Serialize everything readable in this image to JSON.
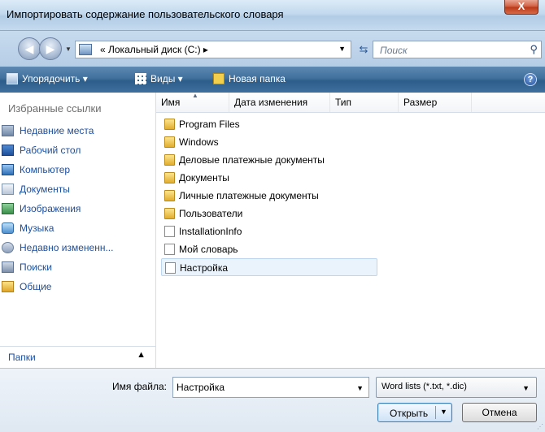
{
  "window": {
    "title": "Импортировать содержание пользовательского словаря",
    "close_glyph": "X"
  },
  "address": {
    "path": "« Локальный диск (C:) ▸",
    "search_placeholder": "Поиск"
  },
  "toolbar": {
    "organize_label": "Упорядочить ▾",
    "views_label": "Виды ▾",
    "new_folder_label": "Новая папка"
  },
  "sidebar": {
    "header": "Избранные ссылки",
    "items": [
      {
        "label": "Недавние места",
        "icon": "recent-places-icon"
      },
      {
        "label": "Рабочий стол",
        "icon": "desktop-icon"
      },
      {
        "label": "Компьютер",
        "icon": "computer-icon"
      },
      {
        "label": "Документы",
        "icon": "documents-icon"
      },
      {
        "label": "Изображения",
        "icon": "images-icon"
      },
      {
        "label": "Музыка",
        "icon": "music-icon"
      },
      {
        "label": "Недавно измененн...",
        "icon": "recently-changed-icon"
      },
      {
        "label": "Поиски",
        "icon": "searches-icon"
      },
      {
        "label": "Общие",
        "icon": "public-folder-icon"
      }
    ],
    "folders_label": "Папки"
  },
  "filelist": {
    "columns": [
      "Имя",
      "Дата изменения",
      "Тип",
      "Размер"
    ],
    "items": [
      {
        "name": "Program Files",
        "kind": "folder"
      },
      {
        "name": "Windows",
        "kind": "folder"
      },
      {
        "name": "Деловые платежные документы",
        "kind": "folder"
      },
      {
        "name": "Документы",
        "kind": "folder"
      },
      {
        "name": "Личные платежные документы",
        "kind": "folder"
      },
      {
        "name": "Пользователи",
        "kind": "folder"
      },
      {
        "name": "InstallationInfo",
        "kind": "file"
      },
      {
        "name": "Мой словарь",
        "kind": "file"
      },
      {
        "name": "Настройка",
        "kind": "file",
        "selected": true
      }
    ]
  },
  "footer": {
    "filename_label": "Имя файла:",
    "filename_value": "Настройка",
    "filetype_value": "Word lists (*.txt, *.dic)",
    "open_label": "Открыть",
    "cancel_label": "Отмена"
  },
  "colors": {
    "accent": "#2d5d8a",
    "link": "#1c4fa0",
    "selection": "#eaf3fc"
  }
}
